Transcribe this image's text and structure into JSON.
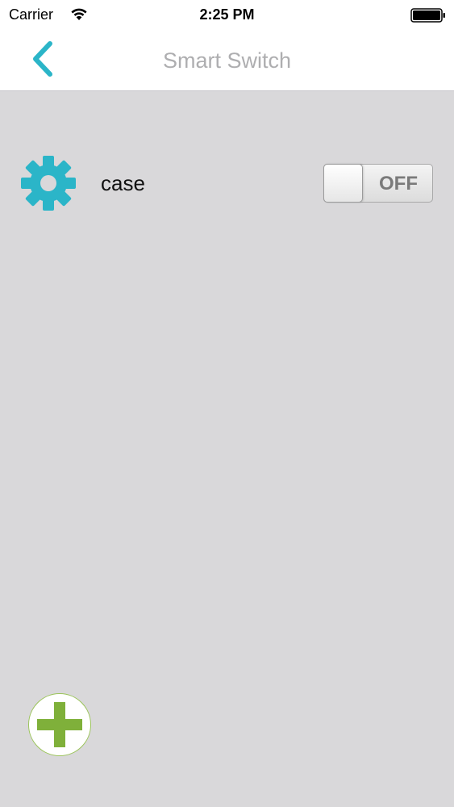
{
  "status_bar": {
    "carrier": "Carrier",
    "time": "2:25 PM",
    "wifi_icon": "wifi-icon",
    "battery_icon": "battery-full-icon"
  },
  "nav": {
    "title": "Smart Switch",
    "back_icon": "chevron-left-icon"
  },
  "devices": [
    {
      "icon": "gear-icon",
      "name": "case",
      "switch_label": "OFF",
      "switch_on": false
    }
  ],
  "add_button": {
    "icon": "plus-icon"
  },
  "colors": {
    "accent": "#2bb5c8",
    "add_green": "#7fb03a",
    "background": "#d9d8da",
    "title_gray": "#aeaeb0"
  }
}
